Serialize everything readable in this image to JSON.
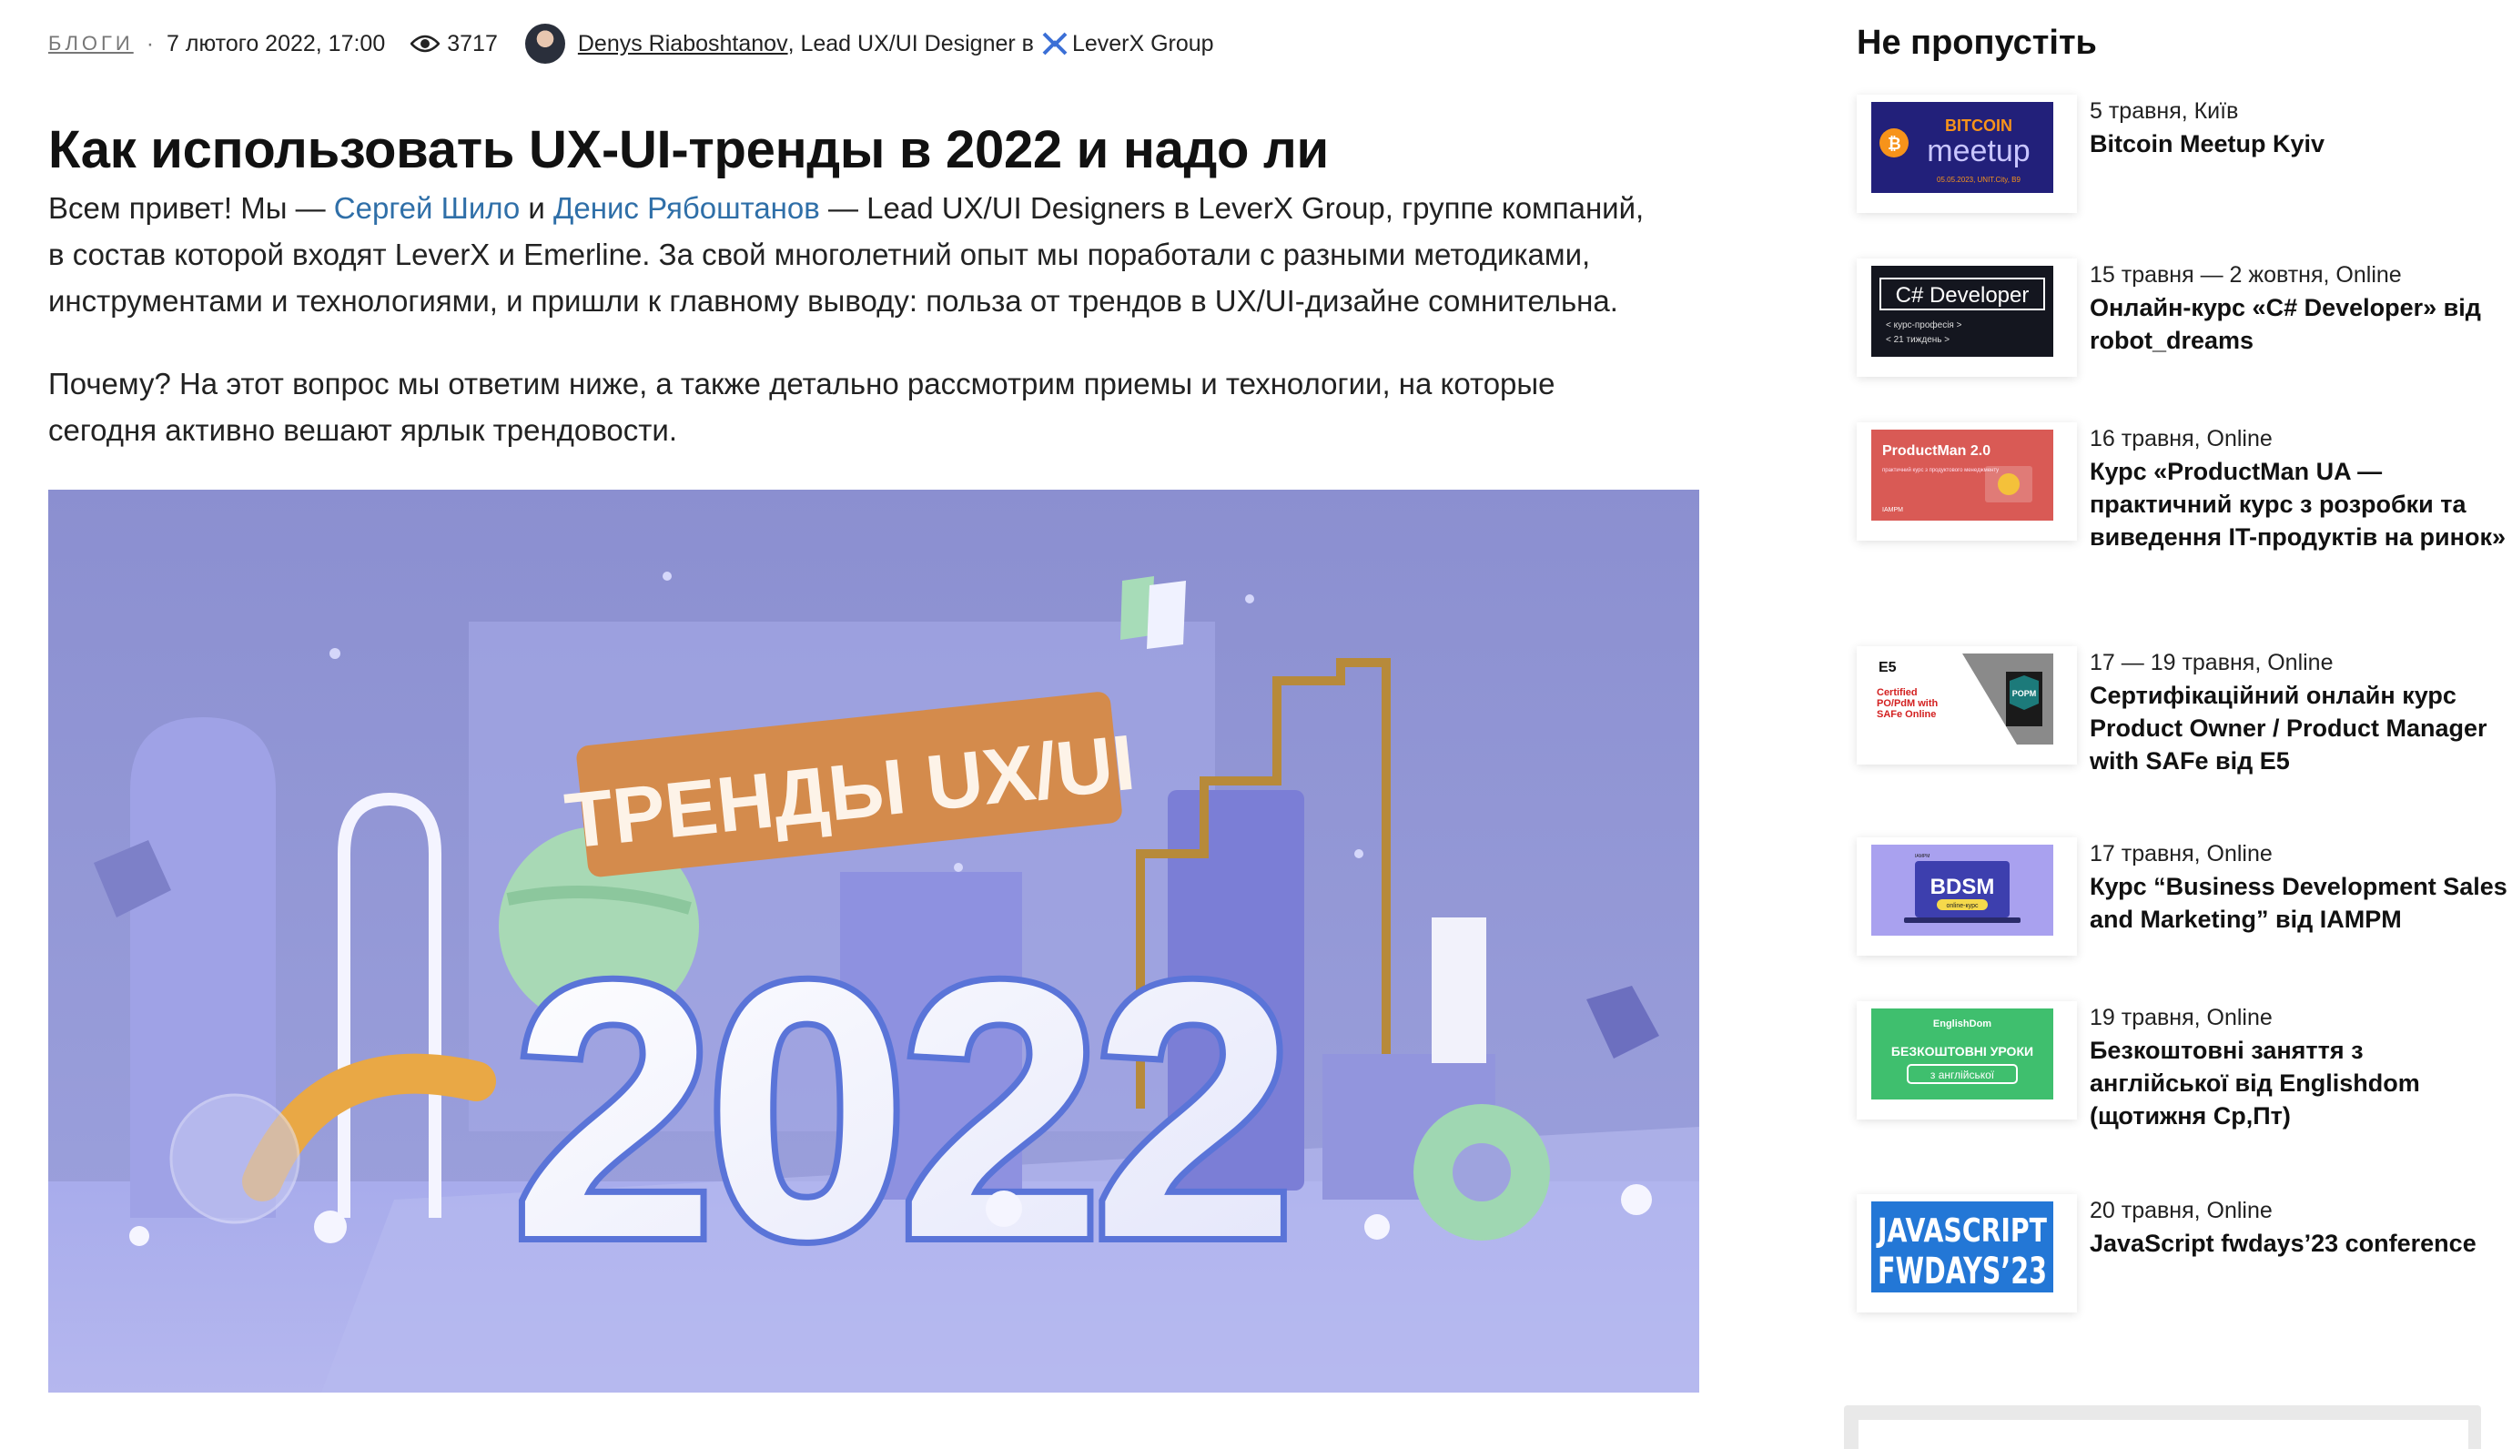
{
  "article": {
    "category": "БЛОГИ",
    "separator": "·",
    "date": "7 лютого 2022, 17:00",
    "views": "3717",
    "author": "Denys Riaboshtanov",
    "author_role": ", Lead UX/UI Designer в ",
    "company": "LeverX Group",
    "title": "Как использовать UX-UI-тренды в 2022 и надо ли",
    "p1": {
      "t1": "Всем привет! Мы — ",
      "link1": "Сергей Шило",
      "t2": " и ",
      "link2": "Денис Рябоштанов",
      "t3": " — Lead UX/UI Designers в LeverX Group, группе компаний,",
      "line2": "в состав которой входят LeverX и Emerline. За свой многолетний опыт мы поработали с разными методиками,",
      "line3": "инструментами и технологиями, и пришли к главному выводу: польза от трендов в UX/UI-дизайне сомнительна."
    },
    "p2": {
      "line1": "Почему? На этот вопрос мы ответим ниже, а также детально рассмотрим приемы и технологии, на которые",
      "line2": "сегодня активно вешают ярлык трендовости."
    },
    "hero": {
      "banner_text": "ТРЕНДЫ UX/UI",
      "year": "2022"
    }
  },
  "sidebar": {
    "title": "Не пропустіть",
    "events": [
      {
        "date": "5 травня, Київ",
        "name": "Bitcoin Meetup Kyiv",
        "thumb": {
          "l1": "BITCOIN",
          "l2": "meetup",
          "l3": "05.05.2023, UNIT.City, B9"
        }
      },
      {
        "date": "15 травня — 2 жовтня, Online",
        "name": "Онлайн-курс «C# Developer» від robot_dreams",
        "thumb": {
          "l1": "C# Developer",
          "l2": "< курс-професія >",
          "l3": "< 21 тиждень >"
        }
      },
      {
        "date": "16 травня, Online",
        "name": "Курс «ProductMan UA — практичний курс з розробки та виведення IT-продуктів на ринок»",
        "thumb": {
          "l1": "ProductMan 2.0",
          "l2": "практичний курс з продуктового менеджменту",
          "l3": "IAMPM"
        }
      },
      {
        "date": "17 — 19 травня, Online",
        "name": "Сертифікаційний онлайн курс Product Owner / Product Manager with SAFe від E5",
        "thumb": {
          "l1": "Certified",
          "l2": "PO/PdM with",
          "l3": "SAFe Online",
          "badge": "POPM",
          "logo": "E5"
        }
      },
      {
        "date": "17 травня, Online",
        "name": "Курс “Business Development Sales and Marketing” від IAMPM",
        "thumb": {
          "l1": "BDSM",
          "l2": "online-курс",
          "l3": "IAMPM"
        }
      },
      {
        "date": "19 травня, Online",
        "name": "Безкоштовні заняття з англійської від Englishdom (щотижня Ср,Пт)",
        "thumb": {
          "l1": "EnglishDom",
          "l2": "БЕЗКОШТОВНІ УРОКИ",
          "l3": "з англійської"
        }
      },
      {
        "date": "20 травня, Online",
        "name": "JavaScript fwdays’23 conference",
        "thumb": {
          "l1": "JAVASCRIPT",
          "l2": "FWDAYS’23"
        }
      }
    ]
  },
  "colors": {
    "link": "#2f6fa8",
    "hero_bg": "#8f93d3",
    "banner": "#d48b4c"
  }
}
